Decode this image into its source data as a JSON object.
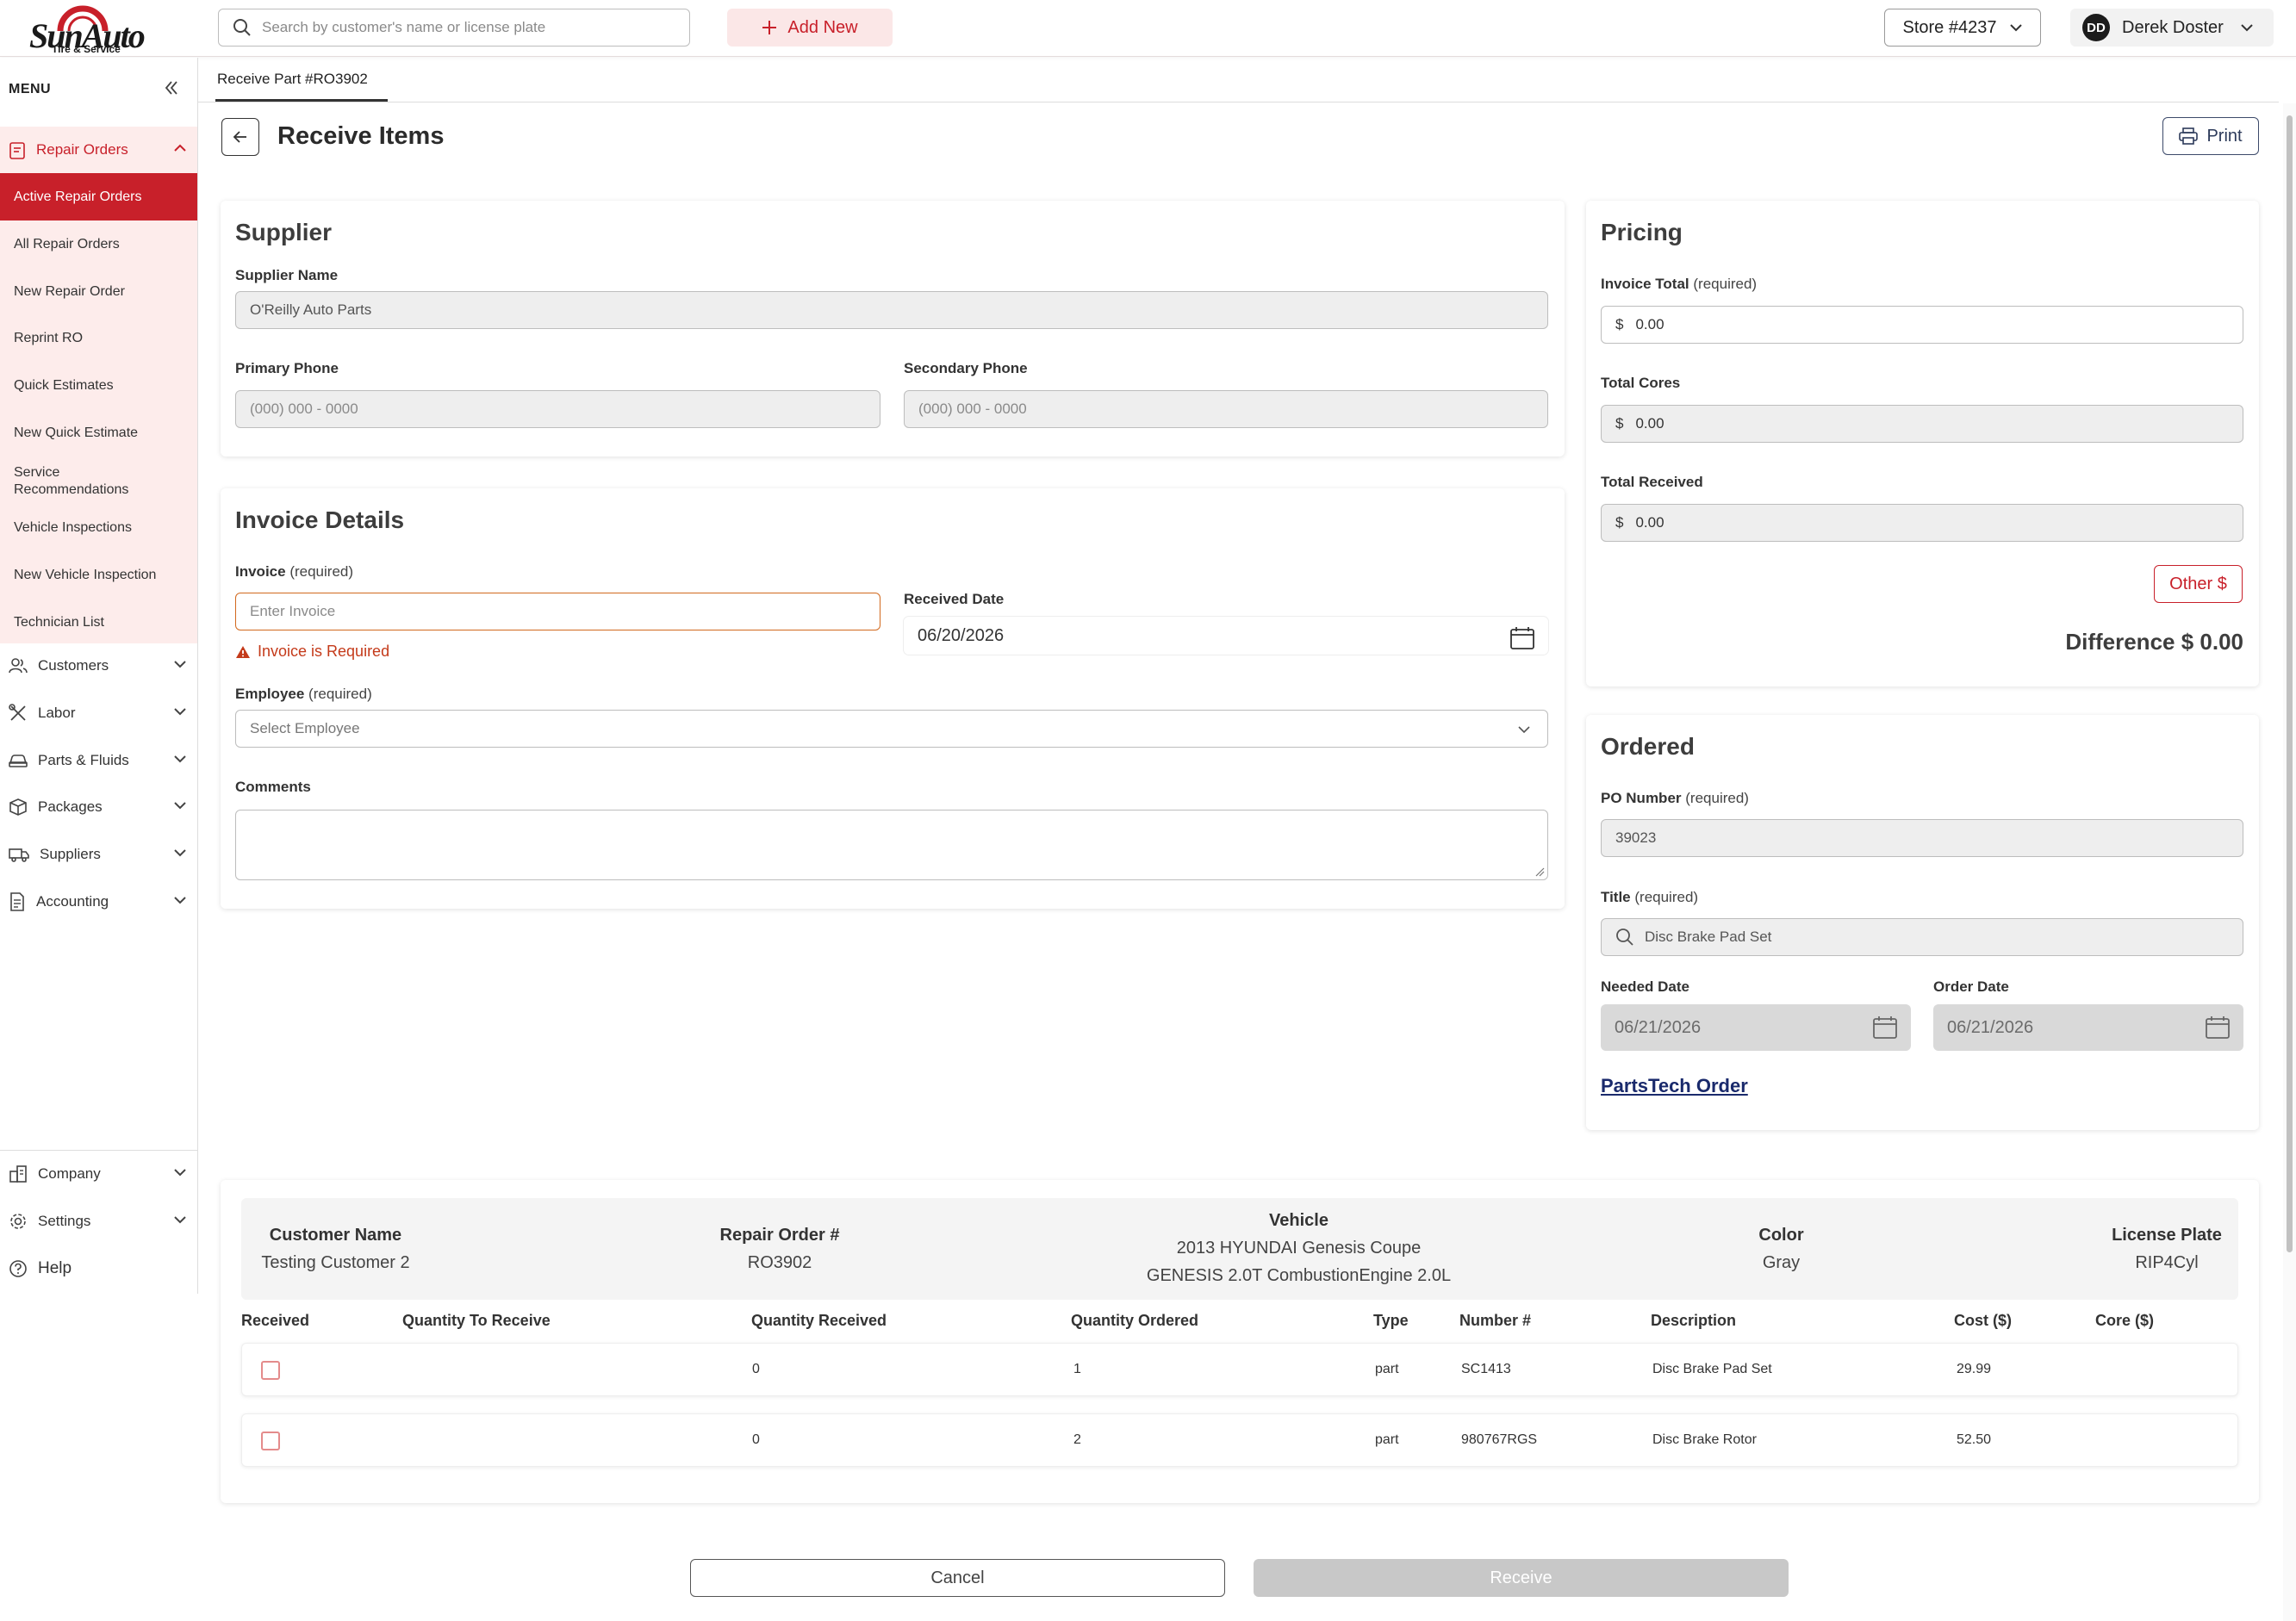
{
  "app": {
    "logo_text": "SunAuto",
    "logo_sub": "Tire & Service",
    "search_placeholder": "Search by customer's name or license plate",
    "add_new": "Add New",
    "store": "Store #4237",
    "user_initials": "DD",
    "user_name": "Derek Doster"
  },
  "colors": {
    "brand": "#c8202a",
    "active_bg": "#fdeceb",
    "link": "#1a2a6c",
    "error": "#c43a1a"
  },
  "sidebar": {
    "menu_label": "MENU",
    "sections": [
      {
        "label": "Repair Orders",
        "icon": "clipboard-icon",
        "expanded": true
      },
      {
        "label": "Customers",
        "icon": "users-icon"
      },
      {
        "label": "Labor",
        "icon": "tools-icon"
      },
      {
        "label": "Parts & Fluids",
        "icon": "car-icon"
      },
      {
        "label": "Packages",
        "icon": "box-icon"
      },
      {
        "label": "Suppliers",
        "icon": "truck-icon"
      },
      {
        "label": "Accounting",
        "icon": "document-icon"
      }
    ],
    "repair_items": [
      "Active Repair Orders",
      "All Repair Orders",
      "New Repair Order",
      "Reprint RO",
      "Quick Estimates",
      "New Quick Estimate",
      "Service Recommendations",
      "Vehicle Inspections",
      "New Vehicle Inspection",
      "Technician List"
    ],
    "bottom": [
      {
        "label": "Company",
        "icon": "building-icon"
      },
      {
        "label": "Settings",
        "icon": "gear-icon"
      },
      {
        "label": "Help",
        "icon": "help-icon"
      }
    ]
  },
  "tab": {
    "label": "Receive Part #RO3902"
  },
  "header": {
    "title": "Receive Items",
    "print": "Print"
  },
  "supplier": {
    "title": "Supplier",
    "name_label": "Supplier Name",
    "name_value": "O'Reilly Auto Parts",
    "primary_label": "Primary Phone",
    "primary_placeholder": "(000) 000 - 0000",
    "secondary_label": "Secondary Phone",
    "secondary_placeholder": "(000) 000 - 0000"
  },
  "invoice": {
    "title": "Invoice Details",
    "invoice_label": "Invoice",
    "required": "(required)",
    "invoice_placeholder": "Enter Invoice",
    "invoice_error": "Invoice is Required",
    "received_label": "Received Date",
    "received_value": "06/20/2026",
    "employee_label": "Employee",
    "employee_placeholder": "Select Employee",
    "comments_label": "Comments"
  },
  "pricing": {
    "title": "Pricing",
    "invoice_total_label": "Invoice Total",
    "required": "(required)",
    "currency": "$",
    "invoice_total": "0.00",
    "total_cores_label": "Total Cores",
    "total_cores": "0.00",
    "total_received_label": "Total Received",
    "total_received": "0.00",
    "other_button": "Other $",
    "difference": "Difference $ 0.00"
  },
  "ordered": {
    "title": "Ordered",
    "po_label": "PO Number",
    "required": "(required)",
    "po_value": "39023",
    "title_label": "Title",
    "title_value": "Disc Brake Pad Set",
    "needed_label": "Needed Date",
    "needed_value": "06/21/2026",
    "order_label": "Order Date",
    "order_value": "06/21/2026",
    "link": "PartsTech Order"
  },
  "summary": {
    "customer_label": "Customer Name",
    "customer_value": "Testing Customer 2",
    "ro_label": "Repair Order #",
    "ro_value": "RO3902",
    "vehicle_label": "Vehicle",
    "vehicle_line1": "2013 HYUNDAI Genesis Coupe",
    "vehicle_line2": "GENESIS 2.0T CombustionEngine 2.0L",
    "color_label": "Color",
    "color_value": "Gray",
    "plate_label": "License Plate",
    "plate_value": "RIP4Cyl"
  },
  "table": {
    "headers": [
      "Received",
      "Quantity To Receive",
      "Quantity Received",
      "Quantity Ordered",
      "Type",
      "Number #",
      "Description",
      "Cost ($)",
      "Core ($)"
    ],
    "rows": [
      {
        "received": false,
        "qty_received": "0",
        "qty_ordered": "1",
        "type": "part",
        "number": "SC1413",
        "description": "Disc Brake Pad Set",
        "cost": "29.99",
        "core": ""
      },
      {
        "received": false,
        "qty_received": "0",
        "qty_ordered": "2",
        "type": "part",
        "number": "980767RGS",
        "description": "Disc Brake Rotor",
        "cost": "52.50",
        "core": ""
      }
    ]
  },
  "actions": {
    "cancel": "Cancel",
    "receive": "Receive"
  }
}
